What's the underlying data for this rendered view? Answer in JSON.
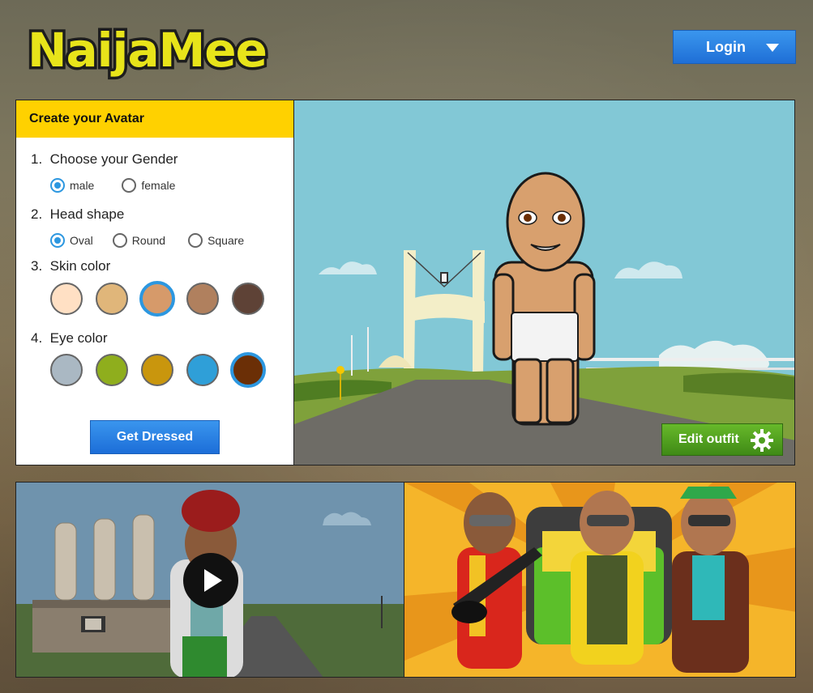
{
  "header": {
    "logo_text": "NaijaMee",
    "login_label": "Login"
  },
  "avatar_panel": {
    "title": "Create your Avatar",
    "steps": [
      {
        "number": "1.",
        "label": "Choose your Gender",
        "options": [
          "male",
          "female"
        ],
        "selected": "male"
      },
      {
        "number": "2.",
        "label": "Head shape",
        "options": [
          "Oval",
          "Round",
          "Square"
        ],
        "selected": "Oval"
      },
      {
        "number": "3.",
        "label": "Skin color",
        "colors": [
          "#ffe0c4",
          "#e0b67a",
          "#d69a6a",
          "#b0805e",
          "#5e4236"
        ],
        "selected_index": 2
      },
      {
        "number": "4.",
        "label": "Eye color",
        "colors": [
          "#aab8c3",
          "#8fae1d",
          "#c9960d",
          "#2f9fd8",
          "#6b2f06"
        ],
        "selected_index": 4
      }
    ],
    "get_dressed_label": "Get Dressed"
  },
  "scene": {
    "edit_outfit_label": "Edit outfit",
    "sky_color": "#82c8d6",
    "road_color": "#6e6c66"
  },
  "video": {
    "play_icon": "play-icon"
  },
  "colors": {
    "accent_blue": "#2f86e6",
    "accent_yellow": "#ffd100",
    "accent_green": "#4e9f1f"
  }
}
